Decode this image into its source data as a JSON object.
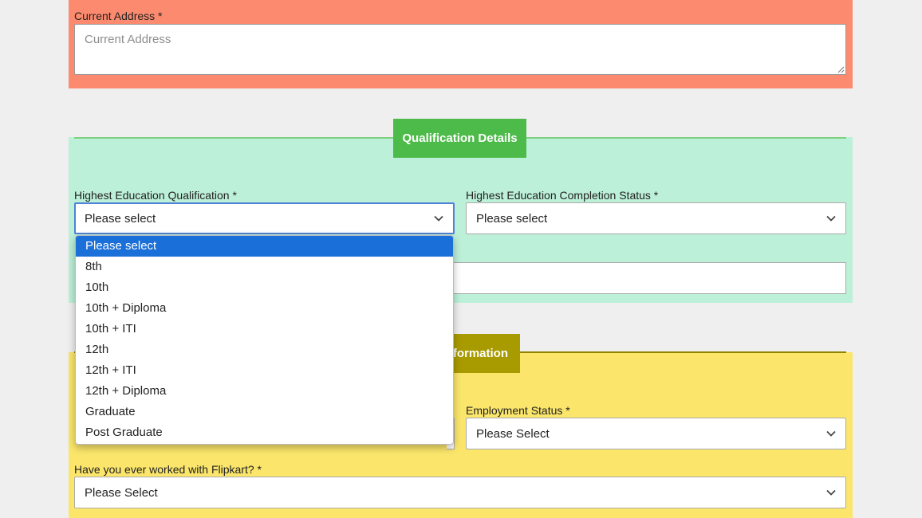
{
  "address": {
    "label": "Current Address *",
    "placeholder": "Current Address"
  },
  "qualification": {
    "heading": "Qualification Details",
    "highest_education": {
      "label": "Highest Education Qualification *",
      "value": "Please select",
      "options": [
        "Please select",
        "8th",
        "10th",
        "10th + Diploma",
        "10th + ITI",
        "12th",
        "12th + ITI",
        "12th + Diploma",
        "Graduate",
        "Post Graduate"
      ],
      "selected_index": 0
    },
    "completion_status": {
      "label": "Highest Education Completion Status *",
      "value": "Please select"
    }
  },
  "employment": {
    "heading_visible_text": "formation",
    "status": {
      "label": "Employment Status *",
      "value": "Please Select"
    },
    "flipkart": {
      "label": "Have you ever worked with Flipkart? *",
      "value": "Please Select"
    }
  },
  "colors": {
    "address_panel": "#fc8a6e",
    "qualification_panel": "#bdf0d8",
    "qualification_heading": "#4dbb4a",
    "employment_panel": "#fbe66b",
    "employment_heading": "#a89b00",
    "option_highlight": "#1a6fd8"
  },
  "icons": {
    "select_arrow": "chevron-down-icon",
    "textarea_resize": "resize-handle-icon"
  }
}
